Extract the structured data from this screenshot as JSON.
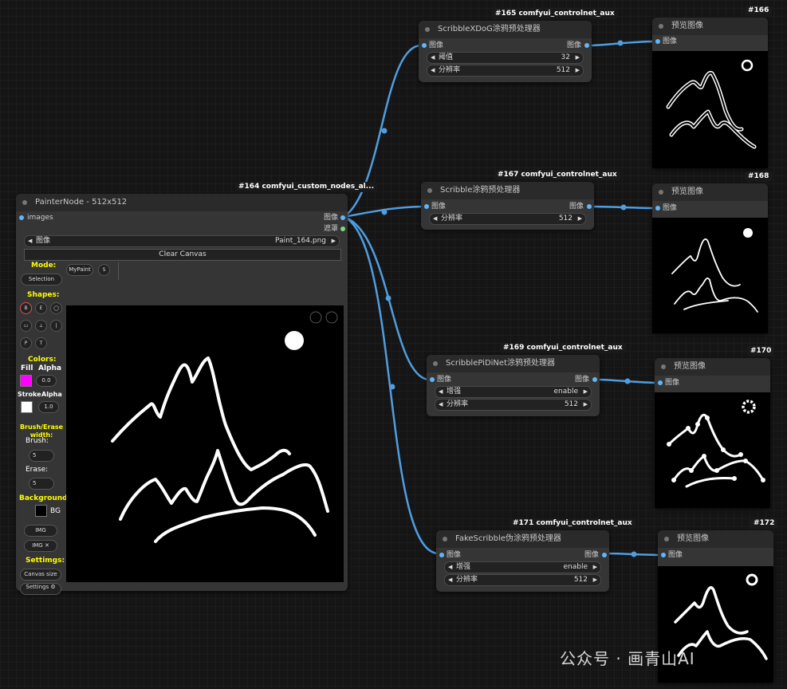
{
  "colors": {
    "wire": "#4f9ee0",
    "slot_blue": "#64b5f6",
    "slot_green": "#7ed87e",
    "label_yellow": "#ffff00",
    "fill_magenta": "#ff00ff"
  },
  "painter": {
    "badge": "#164 comfyui_custom_nodes_al...",
    "title": "PainterNode - 512x512",
    "input_images": "images",
    "output_image": "图像",
    "output_mask": "遮罩",
    "image_widget": {
      "label": "图像",
      "value": "Paint_164.png"
    },
    "clear_canvas": "Clear Canvas",
    "mode_label": "Mode:",
    "mode_selection": "Selection",
    "mode_mypaint": "MyPaint",
    "mode_s": "S",
    "shapes_label": "Shapes:",
    "shape_buttons": [
      "B",
      "E",
      "◯",
      "▭",
      "⟂",
      "|",
      "P",
      "T"
    ],
    "colors_label": "Colors:",
    "fill_label": "Fill",
    "alpha_label": "Alpha",
    "fill_alpha": "0.0",
    "stroke_label": "Stroke",
    "stroke_alpha": "1.0",
    "brush_erase_label": "Brush/Erase width:",
    "brush_label": "Brush:",
    "brush_value": "5",
    "erase_label": "Erase:",
    "erase_value": "5",
    "background_label": "Background:",
    "bg_label": "BG",
    "img_btn": "IMG",
    "img_x_btn": "IMG ✕",
    "settings_label": "Settimgs:",
    "canvas_size_btn": "Canvas size",
    "settings_btn": "Settings ⚙",
    "undo_icon": "undo-icon",
    "redo_icon": "redo-icon"
  },
  "nodes": [
    {
      "id": "xdog",
      "badge": "#165 comfyui_controlnet_aux",
      "title": "ScribbleXDoG涂鸦预处理器",
      "in": "图像",
      "out": "图像",
      "widgets": [
        {
          "label": "阈值",
          "value": "32"
        },
        {
          "label": "分辨率",
          "value": "512"
        }
      ]
    },
    {
      "id": "scribble",
      "badge": "#167 comfyui_controlnet_aux",
      "title": "Scribble涂鸦预处理器",
      "in": "图像",
      "out": "图像",
      "widgets": [
        {
          "label": "分辨率",
          "value": "512"
        }
      ]
    },
    {
      "id": "pidinet",
      "badge": "#169 comfyui_controlnet_aux",
      "title": "ScribblePiDiNet涂鸦预处理器",
      "in": "图像",
      "out": "图像",
      "widgets": [
        {
          "label": "增强",
          "value": "enable"
        },
        {
          "label": "分辨率",
          "value": "512"
        }
      ]
    },
    {
      "id": "fake",
      "badge": "#171 comfyui_controlnet_aux",
      "title": "FakeScribble伪涂鸦预处理器",
      "in": "图像",
      "out": "图像",
      "widgets": [
        {
          "label": "增强",
          "value": "enable"
        },
        {
          "label": "分辨率",
          "value": "512"
        }
      ]
    }
  ],
  "previews": [
    {
      "badge": "#166",
      "title": "预览图像",
      "in": "图像"
    },
    {
      "badge": "#168",
      "title": "预览图像",
      "in": "图像"
    },
    {
      "badge": "#170",
      "title": "预览图像",
      "in": "图像"
    },
    {
      "badge": "#172",
      "title": "预览图像",
      "in": "图像"
    }
  ],
  "watermark": "公众号 · 画青山AI"
}
